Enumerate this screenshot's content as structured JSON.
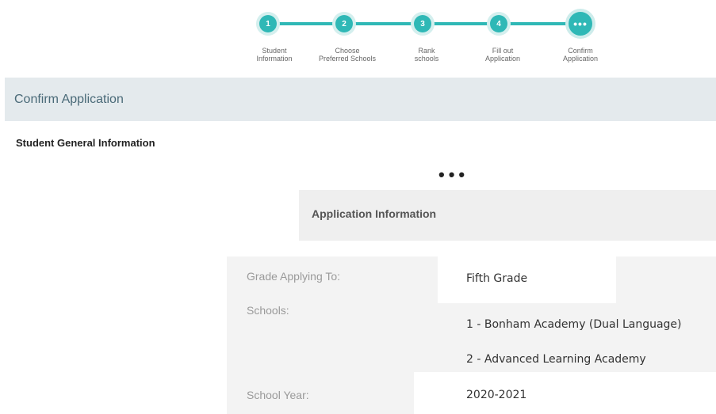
{
  "stepper": {
    "steps": [
      {
        "number": "1",
        "label_line1": "Student",
        "label_line2": "Information"
      },
      {
        "number": "2",
        "label_line1": "Choose",
        "label_line2": "Preferred Schools"
      },
      {
        "number": "3",
        "label_line1": "Rank",
        "label_line2": "schools"
      },
      {
        "number": "4",
        "label_line1": "Fill out",
        "label_line2": "Application"
      },
      {
        "number": "•••",
        "label_line1": "Confirm",
        "label_line2": "Application"
      }
    ],
    "accent_color": "#2fb8b6"
  },
  "header": {
    "title": "Confirm Application"
  },
  "general_info": {
    "heading": "Student General Information"
  },
  "ellipsis": "•••",
  "application_info": {
    "title": "Application Information",
    "fields": {
      "grade_label": "Grade Applying To:",
      "grade_value": "Fifth Grade",
      "schools_label": "Schools:",
      "schools": [
        "1 - Bonham Academy (Dual Language)",
        "2 - Advanced Learning Academy"
      ],
      "year_label": "School Year:",
      "year_value": "2020-2021"
    }
  }
}
